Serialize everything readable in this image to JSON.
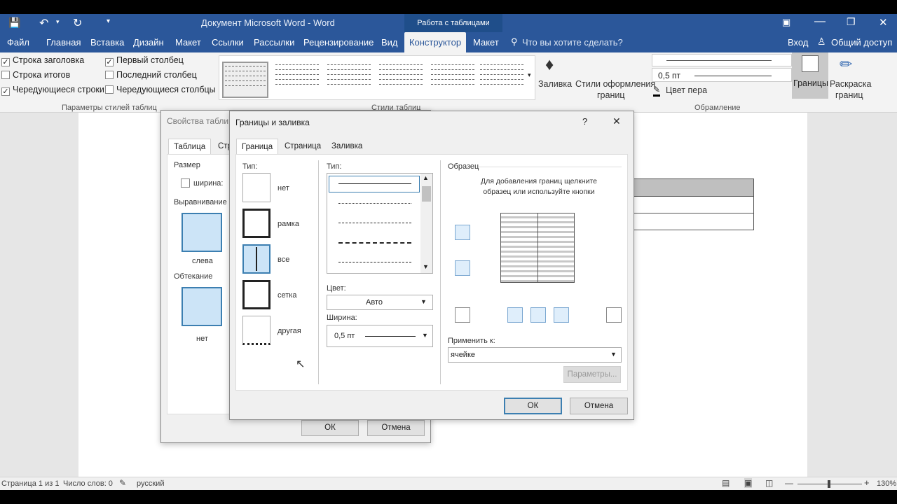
{
  "window": {
    "title": "Документ Microsoft Word - Word",
    "context_tab": "Работа с таблицами"
  },
  "ribbon_tabs": [
    "Файл",
    "Главная",
    "Вставка",
    "Дизайн",
    "Макет",
    "Ссылки",
    "Рассылки",
    "Рецензирование",
    "Вид",
    "Конструктор",
    "Макет"
  ],
  "tell_me": "Что вы хотите сделать?",
  "account": {
    "signin": "Вход",
    "share": "Общий доступ"
  },
  "style_options": {
    "header_row": "Строка заголовка",
    "total_row": "Строка итогов",
    "banded_rows": "Чередующиеся строки",
    "first_column": "Первый столбец",
    "last_column": "Последний столбец",
    "banded_columns": "Чередующиеся столбцы",
    "group": "Параметры стилей таблиц",
    "checked": [
      "header_row",
      "banded_rows",
      "first_column"
    ]
  },
  "table_styles": {
    "group": "Стили таблиц"
  },
  "borders_group": {
    "shading": "Заливка",
    "border_styles": "Стили оформления",
    "border_styles2": "границ",
    "weight": "0,5 пт",
    "pen_color": "Цвет пера",
    "borders": "Границы",
    "painter": "Раскраска",
    "painter2": "границ",
    "group": "Обрамление"
  },
  "table_props": {
    "title": "Свойства таблицы",
    "tab_table": "Таблица",
    "tab_row": "Стр",
    "size": "Размер",
    "width": "ширина:",
    "alignment": "Выравнивание",
    "align_left": "слева",
    "wrapping": "Обтекание",
    "wrap_none": "нет",
    "ok": "ОК",
    "cancel": "Отмена"
  },
  "borders_dialog": {
    "title": "Границы и заливка",
    "help": "?",
    "close": "✕",
    "tabs": [
      "Граница",
      "Страница",
      "Заливка"
    ],
    "setting_label": "Тип:",
    "settings": [
      "нет",
      "рамка",
      "все",
      "сетка",
      "другая"
    ],
    "style_label": "Тип:",
    "color_label": "Цвет:",
    "color_value": "Авто",
    "width_label": "Ширина:",
    "width_value": "0,5 пт",
    "preview_label": "Образец",
    "preview_hint": "Для добавления границ щелкните образец или используйте кнопки",
    "apply_label": "Применить к:",
    "apply_value": "ячейке",
    "options": "Параметры...",
    "ok": "ОК",
    "cancel": "Отмена"
  },
  "status": {
    "page": "Страница 1 из 1",
    "words": "Число слов: 0",
    "lang": "русский",
    "zoom": "130%"
  }
}
